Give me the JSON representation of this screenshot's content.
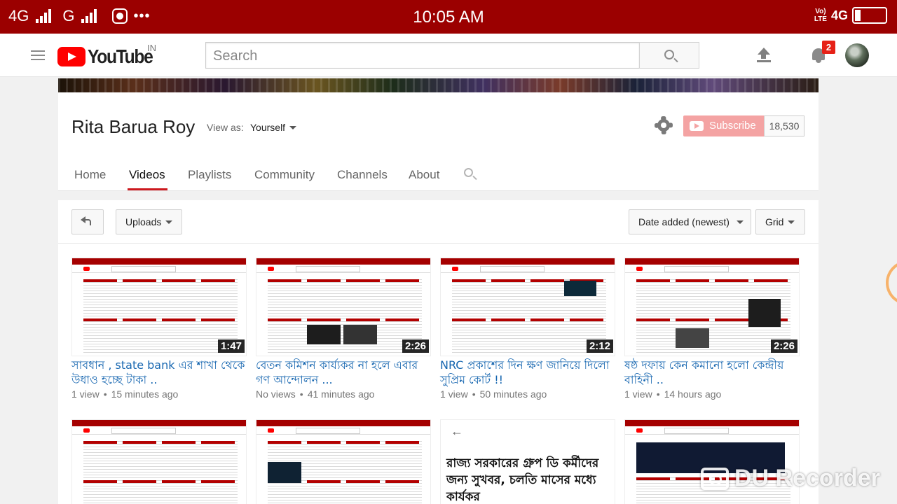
{
  "status_bar": {
    "left_net1": "4G",
    "left_net2": "G",
    "more": "•••",
    "time": "10:05 AM",
    "volte_top": "Vo)",
    "volte_bottom": "LTE",
    "right_net": "4G"
  },
  "header": {
    "logo_text": "YouTube",
    "country": "IN",
    "search_placeholder": "Search",
    "notification_count": "2"
  },
  "channel": {
    "name": "Rita Barua Roy",
    "view_as_label": "View as:",
    "view_as_value": "Yourself",
    "subscribe_label": "Subscribe",
    "subscriber_count": "18,530",
    "tabs": [
      "Home",
      "Videos",
      "Playlists",
      "Community",
      "Channels",
      "About"
    ],
    "active_tab": "Videos"
  },
  "toolbar": {
    "uploads_label": "Uploads",
    "sort_label": "Date added (newest)",
    "view_label": "Grid"
  },
  "videos": [
    {
      "title": "সাবধান , state bank এর শাখা থেকে উধাও হচ্ছে টাকা ..",
      "views": "1 view",
      "age": "15 minutes ago",
      "duration": "1:47"
    },
    {
      "title": "বেতন কমিশন কার্য্যকর না হলে এবার গণ আন্দোলন ...",
      "views": "No views",
      "age": "41 minutes ago",
      "duration": "2:26"
    },
    {
      "title": "NRC প্রকাশের দিন ক্ষণ জানিয়ে দিলো সুপ্রিম কোর্ট !!",
      "views": "1 view",
      "age": "50 minutes ago",
      "duration": "2:12"
    },
    {
      "title": "ষষ্ঠ দফায় কেন কমানো হলো কেন্দ্রীয় বাহিনী ..",
      "views": "1 view",
      "age": "14 hours ago",
      "duration": "2:26"
    }
  ],
  "row2_thumb_text": "রাজ্য সরকারের গ্রুপ ডি কর্মীদের জন্য সুখবর, চলতি মাসের মধ্যে কার্যকর",
  "watermark": "DU Recorder",
  "colors": {
    "status_bar": "#9b0000",
    "youtube_red": "#ff0000",
    "link_blue": "#1666b0",
    "subscribe_disabled": "#f4a3a3",
    "tab_underline": "#cc181e"
  },
  "icons": [
    "hamburger-icon",
    "search-icon",
    "upload-icon",
    "bell-icon",
    "gear-icon",
    "back-icon",
    "dropdown-caret-icon",
    "camera-icon"
  ]
}
